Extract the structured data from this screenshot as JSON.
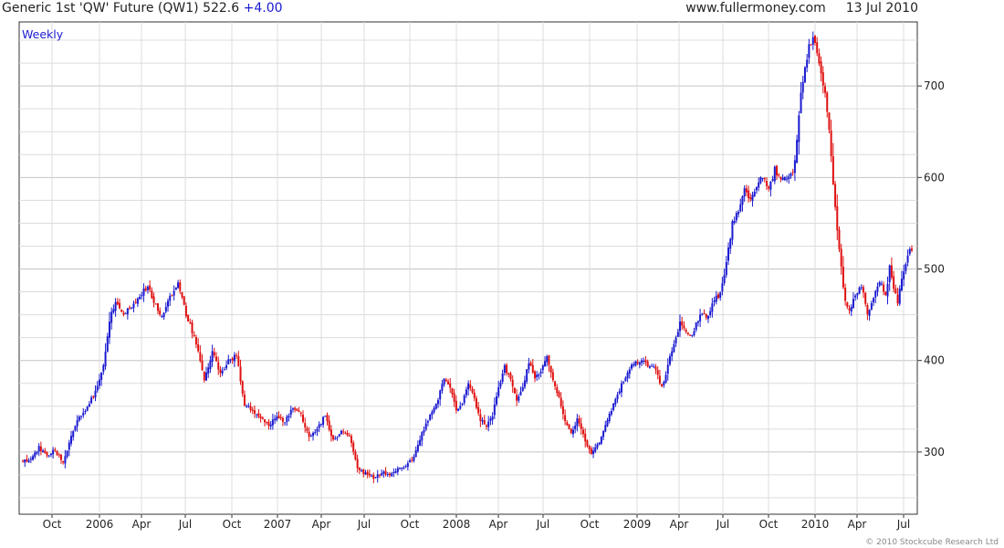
{
  "header": {
    "instrument": "Generic 1st 'QW' Future (QW1)",
    "last": "522.6",
    "change": "+4.00",
    "source": "www.fullermoney.com",
    "date": "13 Jul 2010"
  },
  "period_label": "Weekly",
  "credit": "© 2010 Stockcube Research Ltd",
  "colors": {
    "up": "#1a1ad0",
    "down": "#e01010",
    "grid": "#dcdcdc",
    "axis": "#333333"
  },
  "chart_data": {
    "type": "candlestick",
    "frequency": "weekly",
    "ylim": [
      232,
      770
    ],
    "y_ticks": [
      300,
      400,
      500,
      600,
      700
    ],
    "x_ticks": [
      "Oct",
      "2006",
      "Apr",
      "Jul",
      "Oct",
      "2007",
      "Apr",
      "Jul",
      "Oct",
      "2008",
      "Apr",
      "Jul",
      "Oct",
      "2009",
      "Apr",
      "Jul",
      "Oct",
      "2010",
      "Apr",
      "Jul"
    ],
    "close_points": [
      {
        "x": 0,
        "y": 290
      },
      {
        "x": 4,
        "y": 292
      },
      {
        "x": 8,
        "y": 305
      },
      {
        "x": 12,
        "y": 296
      },
      {
        "x": 16,
        "y": 302
      },
      {
        "x": 20,
        "y": 288
      },
      {
        "x": 26,
        "y": 330
      },
      {
        "x": 32,
        "y": 350
      },
      {
        "x": 36,
        "y": 365
      },
      {
        "x": 40,
        "y": 395
      },
      {
        "x": 43,
        "y": 445
      },
      {
        "x": 46,
        "y": 462
      },
      {
        "x": 50,
        "y": 452
      },
      {
        "x": 54,
        "y": 458
      },
      {
        "x": 58,
        "y": 470
      },
      {
        "x": 62,
        "y": 482
      },
      {
        "x": 65,
        "y": 463
      },
      {
        "x": 69,
        "y": 448
      },
      {
        "x": 73,
        "y": 468
      },
      {
        "x": 77,
        "y": 483
      },
      {
        "x": 81,
        "y": 450
      },
      {
        "x": 86,
        "y": 420
      },
      {
        "x": 90,
        "y": 378
      },
      {
        "x": 94,
        "y": 410
      },
      {
        "x": 98,
        "y": 385
      },
      {
        "x": 102,
        "y": 400
      },
      {
        "x": 106,
        "y": 405
      },
      {
        "x": 110,
        "y": 352
      },
      {
        "x": 114,
        "y": 345
      },
      {
        "x": 118,
        "y": 338
      },
      {
        "x": 122,
        "y": 328
      },
      {
        "x": 126,
        "y": 340
      },
      {
        "x": 130,
        "y": 333
      },
      {
        "x": 134,
        "y": 348
      },
      {
        "x": 138,
        "y": 340
      },
      {
        "x": 142,
        "y": 316
      },
      {
        "x": 146,
        "y": 325
      },
      {
        "x": 150,
        "y": 340
      },
      {
        "x": 154,
        "y": 312
      },
      {
        "x": 158,
        "y": 322
      },
      {
        "x": 162,
        "y": 318
      },
      {
        "x": 166,
        "y": 282
      },
      {
        "x": 170,
        "y": 276
      },
      {
        "x": 174,
        "y": 272
      },
      {
        "x": 178,
        "y": 278
      },
      {
        "x": 182,
        "y": 275
      },
      {
        "x": 186,
        "y": 282
      },
      {
        "x": 190,
        "y": 285
      },
      {
        "x": 194,
        "y": 295
      },
      {
        "x": 198,
        "y": 320
      },
      {
        "x": 202,
        "y": 340
      },
      {
        "x": 206,
        "y": 358
      },
      {
        "x": 209,
        "y": 382
      },
      {
        "x": 212,
        "y": 372
      },
      {
        "x": 215,
        "y": 345
      },
      {
        "x": 218,
        "y": 352
      },
      {
        "x": 221,
        "y": 375
      },
      {
        "x": 224,
        "y": 358
      },
      {
        "x": 227,
        "y": 335
      },
      {
        "x": 230,
        "y": 328
      },
      {
        "x": 233,
        "y": 340
      },
      {
        "x": 236,
        "y": 370
      },
      {
        "x": 239,
        "y": 393
      },
      {
        "x": 242,
        "y": 378
      },
      {
        "x": 245,
        "y": 355
      },
      {
        "x": 248,
        "y": 372
      },
      {
        "x": 251,
        "y": 397
      },
      {
        "x": 254,
        "y": 382
      },
      {
        "x": 257,
        "y": 388
      },
      {
        "x": 260,
        "y": 405
      },
      {
        "x": 263,
        "y": 380
      },
      {
        "x": 266,
        "y": 360
      },
      {
        "x": 269,
        "y": 335
      },
      {
        "x": 272,
        "y": 320
      },
      {
        "x": 275,
        "y": 335
      },
      {
        "x": 278,
        "y": 318
      },
      {
        "x": 282,
        "y": 298
      },
      {
        "x": 286,
        "y": 312
      },
      {
        "x": 290,
        "y": 335
      },
      {
        "x": 294,
        "y": 358
      },
      {
        "x": 298,
        "y": 378
      },
      {
        "x": 302,
        "y": 395
      },
      {
        "x": 306,
        "y": 400
      },
      {
        "x": 310,
        "y": 395
      },
      {
        "x": 314,
        "y": 390
      },
      {
        "x": 317,
        "y": 370
      },
      {
        "x": 320,
        "y": 395
      },
      {
        "x": 323,
        "y": 420
      },
      {
        "x": 326,
        "y": 440
      },
      {
        "x": 329,
        "y": 430
      },
      {
        "x": 332,
        "y": 428
      },
      {
        "x": 336,
        "y": 450
      },
      {
        "x": 340,
        "y": 448
      },
      {
        "x": 343,
        "y": 468
      },
      {
        "x": 346,
        "y": 472
      },
      {
        "x": 349,
        "y": 508
      },
      {
        "x": 352,
        "y": 550
      },
      {
        "x": 355,
        "y": 562
      },
      {
        "x": 358,
        "y": 590
      },
      {
        "x": 361,
        "y": 575
      },
      {
        "x": 364,
        "y": 588
      },
      {
        "x": 367,
        "y": 602
      },
      {
        "x": 370,
        "y": 585
      },
      {
        "x": 373,
        "y": 610
      },
      {
        "x": 376,
        "y": 595
      },
      {
        "x": 379,
        "y": 600
      },
      {
        "x": 382,
        "y": 605
      },
      {
        "x": 384,
        "y": 640
      },
      {
        "x": 386,
        "y": 690
      },
      {
        "x": 388,
        "y": 718
      },
      {
        "x": 390,
        "y": 745
      },
      {
        "x": 392,
        "y": 755
      },
      {
        "x": 394,
        "y": 740
      },
      {
        "x": 396,
        "y": 712
      },
      {
        "x": 398,
        "y": 690
      },
      {
        "x": 400,
        "y": 650
      },
      {
        "x": 402,
        "y": 590
      },
      {
        "x": 404,
        "y": 545
      },
      {
        "x": 406,
        "y": 500
      },
      {
        "x": 408,
        "y": 465
      },
      {
        "x": 410,
        "y": 455
      },
      {
        "x": 413,
        "y": 470
      },
      {
        "x": 416,
        "y": 482
      },
      {
        "x": 419,
        "y": 452
      },
      {
        "x": 422,
        "y": 468
      },
      {
        "x": 425,
        "y": 488
      },
      {
        "x": 428,
        "y": 470
      },
      {
        "x": 430,
        "y": 502
      },
      {
        "x": 432,
        "y": 480
      },
      {
        "x": 434,
        "y": 465
      },
      {
        "x": 436,
        "y": 490
      },
      {
        "x": 438,
        "y": 505
      },
      {
        "x": 440,
        "y": 520
      }
    ]
  }
}
